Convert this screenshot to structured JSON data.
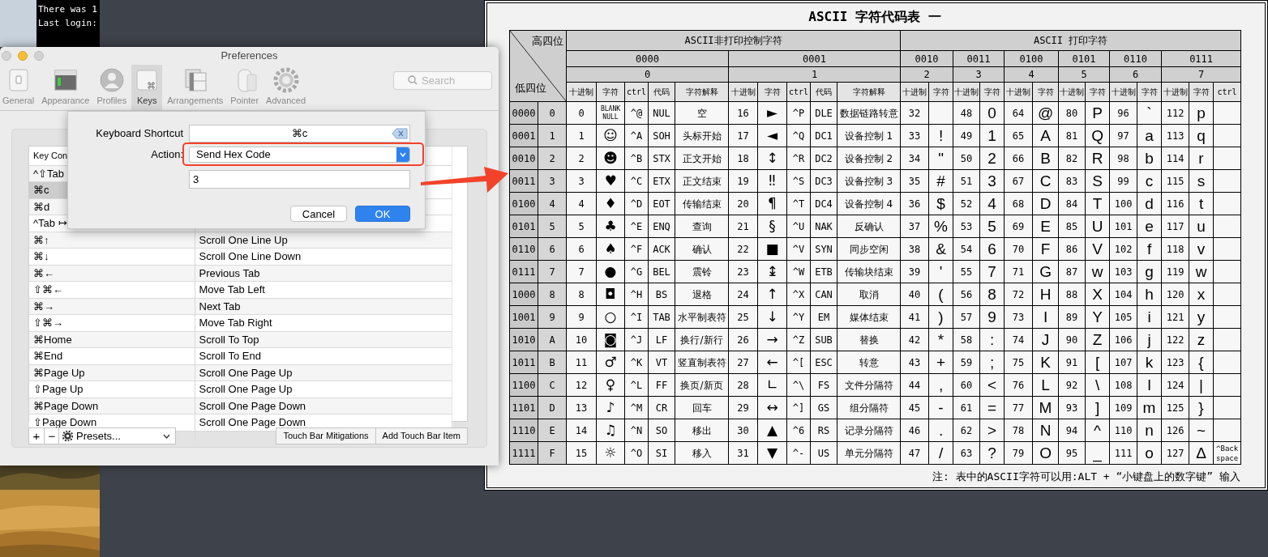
{
  "terminal": {
    "lines": [
      "There was 1",
      "Last login:"
    ]
  },
  "preferences": {
    "title": "Preferences",
    "tabs": [
      {
        "label": "General",
        "selected": false
      },
      {
        "label": "Appearance",
        "selected": false
      },
      {
        "label": "Profiles",
        "selected": false
      },
      {
        "label": "Keys",
        "selected": true
      },
      {
        "label": "Arrangements",
        "selected": false
      },
      {
        "label": "Pointer",
        "selected": false
      },
      {
        "label": "Advanced",
        "selected": false
      }
    ],
    "search": {
      "placeholder": "Search"
    },
    "key_table": {
      "columns": [
        "Key Con"
      ],
      "rows": [
        {
          "key": "^⇧Tab",
          "selected": false
        },
        {
          "key": "⌘c",
          "selected": true
        },
        {
          "key": "⌘d",
          "selected": false
        },
        {
          "key": "^Tab ↦",
          "selected": false
        },
        {
          "key": "⌘↑",
          "action": "Scroll One Line Up",
          "selected": false
        },
        {
          "key": "⌘↓",
          "action": "Scroll One Line Down",
          "selected": false
        },
        {
          "key": "⌘←",
          "action": "Previous Tab",
          "selected": false
        },
        {
          "key": "⇧⌘←",
          "action": "Move Tab Left",
          "selected": false
        },
        {
          "key": "⌘→",
          "action": "Next Tab",
          "selected": false
        },
        {
          "key": "⇧⌘→",
          "action": "Move Tab Right",
          "selected": false
        },
        {
          "key": "⌘Home",
          "action": "Scroll To Top",
          "selected": false
        },
        {
          "key": "⌘End",
          "action": "Scroll To End",
          "selected": false
        },
        {
          "key": "⌘Page Up",
          "action": "Scroll One Page Up",
          "selected": false
        },
        {
          "key": "⇧Page Up",
          "action": "Scroll One Page Up",
          "selected": false
        },
        {
          "key": "⌘Page Down",
          "action": "Scroll One Page Down",
          "selected": false
        },
        {
          "key": "⇧Page Down",
          "action": "Scroll One Page Down",
          "selected": false
        }
      ]
    },
    "add_remove": [
      "+",
      "−"
    ],
    "presets": "Presets...",
    "touch_bar_buttons": [
      "Touch Bar Mitigations",
      "Add Touch Bar Item"
    ]
  },
  "sheet": {
    "shortcut_label": "Keyboard Shortcut",
    "shortcut": "⌘c",
    "action_label": "Action:",
    "action": "Send Hex Code",
    "value": "3",
    "buttons": [
      {
        "label": "Cancel",
        "default": false
      },
      {
        "label": "OK",
        "default": true
      }
    ]
  },
  "ascii_chart": {
    "title": "ASCII 字符代码表 一",
    "corner": {
      "top": "高四位",
      "bottom": "低四位"
    },
    "groups": [
      "ASCII非打印控制字符",
      "ASCII 打印字符"
    ],
    "high_bits": [
      {
        "bin": "0000",
        "hex": "0"
      },
      {
        "bin": "0001",
        "hex": "1"
      },
      {
        "bin": "0010",
        "hex": "2"
      },
      {
        "bin": "0011",
        "hex": "3"
      },
      {
        "bin": "0100",
        "hex": "4"
      },
      {
        "bin": "0101",
        "hex": "5"
      },
      {
        "bin": "0110",
        "hex": "6"
      },
      {
        "bin": "0111",
        "hex": "7"
      }
    ],
    "subheaders": [
      "十进制",
      "字符",
      "ctrl",
      "代码",
      "字符解释",
      "十进制",
      "字符",
      "ctrl",
      "代码",
      "字符解释",
      "十进制",
      "字符",
      "十进制",
      "字符",
      "十进制",
      "字符",
      "十进制",
      "字符",
      "十进制",
      "字符",
      "十进制",
      "字符",
      "ctrl"
    ],
    "rows": [
      {
        "bin": "0000",
        "hex": "0",
        "c0": [
          "0",
          "BLANK NULL",
          "^@",
          "NUL",
          "空"
        ],
        "c1": [
          "16",
          "►",
          "^P",
          "DLE",
          "数据链路转意"
        ],
        "p": [
          [
            "32"
          ],
          [
            "48",
            "0"
          ],
          [
            "64",
            "@"
          ],
          [
            "80",
            "P"
          ],
          [
            "96",
            "`"
          ],
          [
            "112",
            "p"
          ]
        ]
      },
      {
        "bin": "0001",
        "hex": "1",
        "c0": [
          "1",
          "☺",
          "^A",
          "SOH",
          "头标开始"
        ],
        "c1": [
          "17",
          "◄",
          "^Q",
          "DC1",
          "设备控制 1"
        ],
        "p": [
          [
            "33",
            "!"
          ],
          [
            "49",
            "1"
          ],
          [
            "65",
            "A"
          ],
          [
            "81",
            "Q"
          ],
          [
            "97",
            "a"
          ],
          [
            "113",
            "q"
          ]
        ]
      },
      {
        "bin": "0010",
        "hex": "2",
        "c0": [
          "2",
          "☻",
          "^B",
          "STX",
          "正文开始"
        ],
        "c1": [
          "18",
          "↕",
          "^R",
          "DC2",
          "设备控制 2"
        ],
        "p": [
          [
            "34",
            "\""
          ],
          [
            "50",
            "2"
          ],
          [
            "66",
            "B"
          ],
          [
            "82",
            "R"
          ],
          [
            "98",
            "b"
          ],
          [
            "114",
            "r"
          ]
        ]
      },
      {
        "bin": "0011",
        "hex": "3",
        "c0": [
          "3",
          "♥",
          "^C",
          "ETX",
          "正文结束"
        ],
        "c1": [
          "19",
          "‼",
          "^S",
          "DC3",
          "设备控制 3"
        ],
        "p": [
          [
            "35",
            "#"
          ],
          [
            "51",
            "3"
          ],
          [
            "67",
            "C"
          ],
          [
            "83",
            "S"
          ],
          [
            "99",
            "c"
          ],
          [
            "115",
            "s"
          ]
        ]
      },
      {
        "bin": "0100",
        "hex": "4",
        "c0": [
          "4",
          "♦",
          "^D",
          "EOT",
          "传输结束"
        ],
        "c1": [
          "20",
          "¶",
          "^T",
          "DC4",
          "设备控制 4"
        ],
        "p": [
          [
            "36",
            "$"
          ],
          [
            "52",
            "4"
          ],
          [
            "68",
            "D"
          ],
          [
            "84",
            "T"
          ],
          [
            "100",
            "d"
          ],
          [
            "116",
            "t"
          ]
        ]
      },
      {
        "bin": "0101",
        "hex": "5",
        "c0": [
          "5",
          "♣",
          "^E",
          "ENQ",
          "查询"
        ],
        "c1": [
          "21",
          "§",
          "^U",
          "NAK",
          "反确认"
        ],
        "p": [
          [
            "37",
            "%"
          ],
          [
            "53",
            "5"
          ],
          [
            "69",
            "E"
          ],
          [
            "85",
            "U"
          ],
          [
            "101",
            "e"
          ],
          [
            "117",
            "u"
          ]
        ]
      },
      {
        "bin": "0110",
        "hex": "6",
        "c0": [
          "6",
          "♠",
          "^F",
          "ACK",
          "确认"
        ],
        "c1": [
          "22",
          "■",
          "^V",
          "SYN",
          "同步空闲"
        ],
        "p": [
          [
            "38",
            "&"
          ],
          [
            "54",
            "6"
          ],
          [
            "70",
            "F"
          ],
          [
            "86",
            "V"
          ],
          [
            "102",
            "f"
          ],
          [
            "118",
            "v"
          ]
        ]
      },
      {
        "bin": "0111",
        "hex": "7",
        "c0": [
          "7",
          "●",
          "^G",
          "BEL",
          "震铃"
        ],
        "c1": [
          "23",
          "↨",
          "^W",
          "ETB",
          "传输块结束"
        ],
        "p": [
          [
            "39",
            "'"
          ],
          [
            "55",
            "7"
          ],
          [
            "71",
            "G"
          ],
          [
            "87",
            "w"
          ],
          [
            "103",
            "g"
          ],
          [
            "119",
            "w"
          ]
        ]
      },
      {
        "bin": "1000",
        "hex": "8",
        "c0": [
          "8",
          "◘",
          "^H",
          "BS",
          "退格"
        ],
        "c1": [
          "24",
          "↑",
          "^X",
          "CAN",
          "取消"
        ],
        "p": [
          [
            "40",
            "("
          ],
          [
            "56",
            "8"
          ],
          [
            "72",
            "H"
          ],
          [
            "88",
            "X"
          ],
          [
            "104",
            "h"
          ],
          [
            "120",
            "x"
          ]
        ]
      },
      {
        "bin": "1001",
        "hex": "9",
        "c0": [
          "9",
          "○",
          "^I",
          "TAB",
          "水平制表符"
        ],
        "c1": [
          "25",
          "↓",
          "^Y",
          "EM",
          "媒体结束"
        ],
        "p": [
          [
            "41",
            ")"
          ],
          [
            "57",
            "9"
          ],
          [
            "73",
            "I"
          ],
          [
            "89",
            "Y"
          ],
          [
            "105",
            "i"
          ],
          [
            "121",
            "y"
          ]
        ]
      },
      {
        "bin": "1010",
        "hex": "A",
        "c0": [
          "10",
          "◙",
          "^J",
          "LF",
          "换行/新行"
        ],
        "c1": [
          "26",
          "→",
          "^Z",
          "SUB",
          "替换"
        ],
        "p": [
          [
            "42",
            "*"
          ],
          [
            "58",
            ":"
          ],
          [
            "74",
            "J"
          ],
          [
            "90",
            "Z"
          ],
          [
            "106",
            "j"
          ],
          [
            "122",
            "z"
          ]
        ]
      },
      {
        "bin": "1011",
        "hex": "B",
        "c0": [
          "11",
          "♂",
          "^K",
          "VT",
          "竖直制表符"
        ],
        "c1": [
          "27",
          "←",
          "^[",
          "ESC",
          "转意"
        ],
        "p": [
          [
            "43",
            "+"
          ],
          [
            "59",
            ";"
          ],
          [
            "75",
            "K"
          ],
          [
            "91",
            "["
          ],
          [
            "107",
            "k"
          ],
          [
            "123",
            "{"
          ]
        ]
      },
      {
        "bin": "1100",
        "hex": "C",
        "c0": [
          "12",
          "♀",
          "^L",
          "FF",
          "换页/新页"
        ],
        "c1": [
          "28",
          "∟",
          "^\\",
          "FS",
          "文件分隔符"
        ],
        "p": [
          [
            "44",
            ","
          ],
          [
            "60",
            "<"
          ],
          [
            "76",
            "L"
          ],
          [
            "92",
            "\\"
          ],
          [
            "108",
            "l"
          ],
          [
            "124",
            "|"
          ]
        ]
      },
      {
        "bin": "1101",
        "hex": "D",
        "c0": [
          "13",
          "♪",
          "^M",
          "CR",
          "回车"
        ],
        "c1": [
          "29",
          "↔",
          "^]",
          "GS",
          "组分隔符"
        ],
        "p": [
          [
            "45",
            "-"
          ],
          [
            "61",
            "="
          ],
          [
            "77",
            "M"
          ],
          [
            "93",
            "]"
          ],
          [
            "109",
            "m"
          ],
          [
            "125",
            "}"
          ]
        ]
      },
      {
        "bin": "1110",
        "hex": "E",
        "c0": [
          "14",
          "♫",
          "^N",
          "SO",
          "移出"
        ],
        "c1": [
          "30",
          "▲",
          "^6",
          "RS",
          "记录分隔符"
        ],
        "p": [
          [
            "46",
            "."
          ],
          [
            "62",
            ">"
          ],
          [
            "78",
            "N"
          ],
          [
            "94",
            "^"
          ],
          [
            "110",
            "n"
          ],
          [
            "126",
            "~"
          ]
        ]
      },
      {
        "bin": "1111",
        "hex": "F",
        "c0": [
          "15",
          "☼",
          "^O",
          "SI",
          "移入"
        ],
        "c1": [
          "31",
          "▼",
          "^-",
          "US",
          "单元分隔符"
        ],
        "p": [
          [
            "47",
            "/"
          ],
          [
            "63",
            "?"
          ],
          [
            "79",
            "O"
          ],
          [
            "95",
            "_"
          ],
          [
            "111",
            "o"
          ],
          [
            "127",
            "Δ"
          ]
        ],
        "ctrl": "^Back space"
      }
    ],
    "note": "注: 表中的ASCII字符可以用:ALT + “小键盘上的数字键” 输入"
  }
}
